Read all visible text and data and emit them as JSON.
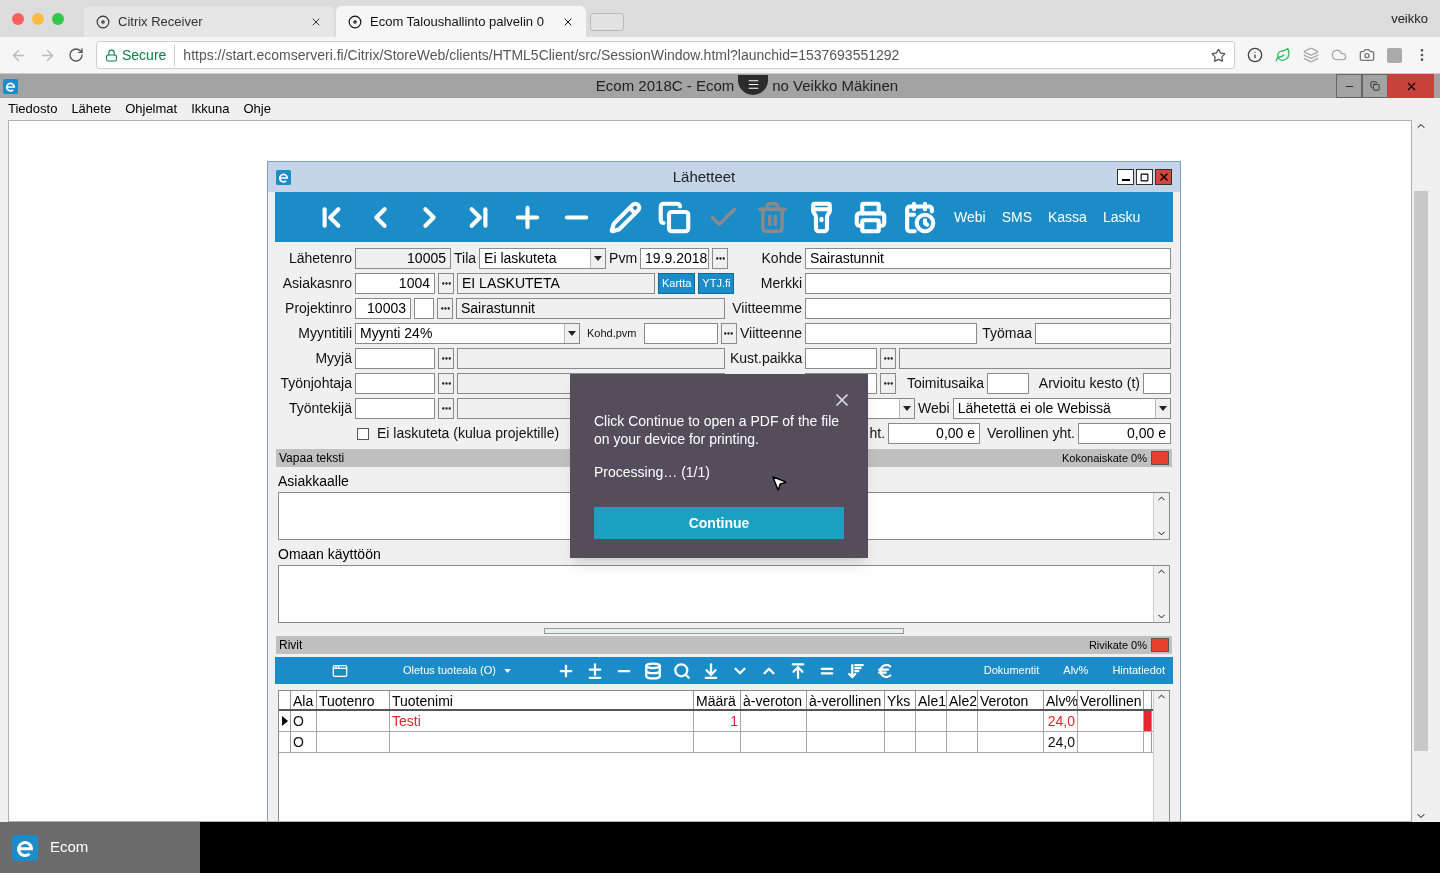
{
  "browser": {
    "tabs": [
      {
        "title": "Citrix Receiver",
        "selected": false
      },
      {
        "title": "Ecom Taloushallinto palvelin 0",
        "selected": true
      }
    ],
    "profile": "veikko",
    "secure_label": "Secure",
    "url": "https://start.ecomserveri.fi/Citrix/StoreWeb/clients/HTML5Client/src/SessionWindow.html?launchid=1537693551292"
  },
  "session_title": [
    "Ecom 2018C - Ecom",
    "no Veikko Mäkinen"
  ],
  "menu": [
    "Tiedosto",
    "Lähete",
    "Ohjelmat",
    "Ikkuna",
    "Ohje"
  ],
  "window": {
    "title": "Lähetteet"
  },
  "toolbar": {
    "tools": [
      {
        "disabled": false
      },
      {
        "disabled": false
      },
      {
        "disabled": false
      },
      {
        "disabled": false
      },
      {
        "disabled": false
      },
      {
        "disabled": false
      },
      {
        "disabled": false
      },
      {
        "disabled": false
      },
      {
        "disabled": true
      },
      {
        "disabled": true
      },
      {
        "disabled": false
      },
      {
        "disabled": false
      },
      {
        "disabled": false
      }
    ],
    "links": [
      "Webi",
      "SMS",
      "Kassa",
      "Lasku"
    ]
  },
  "form": {
    "lahetenro": {
      "label": "Lähetenro",
      "value": "10005"
    },
    "tila": {
      "label": "Tila",
      "value": "Ei laskuteta"
    },
    "pvm": {
      "label": "Pvm",
      "value": "19.9.2018"
    },
    "kohde": {
      "label": "Kohde",
      "value": "Sairastunnit"
    },
    "asiakasnro": {
      "label": "Asiakasnro",
      "value": "1004",
      "name": "EI LASKUTETA"
    },
    "map_buttons": [
      "Kartta",
      "YTJ.fi"
    ],
    "merkki": {
      "label": "Merkki"
    },
    "projektinro": {
      "label": "Projektinro",
      "value": "10003",
      "name": "Sairastunnit"
    },
    "viitteemme": {
      "label": "Viitteemme"
    },
    "myyntitili": {
      "label": "Myyntitili",
      "value": "Myynti 24%"
    },
    "kohd_pvm": {
      "label": "Kohd.pvm"
    },
    "viitteenne": {
      "label": "Viitteenne"
    },
    "tyomaa": {
      "label": "Työmaa"
    },
    "myyja": {
      "label": "Myyjä"
    },
    "kust_paikka": {
      "label": "Kust.paikka"
    },
    "tyonjohtaja": {
      "label": "Työnjohtaja"
    },
    "toimitusaika": {
      "label": "Toimitusaika"
    },
    "arvioitu_kesto": {
      "label": "Arvioitu kesto (t)"
    },
    "tyontekija": {
      "label": "Työntekijä"
    },
    "webi": {
      "label": "Webi",
      "value": "Lähetettä ei ole Webissä"
    },
    "ei_laskuteta": {
      "label": "Ei laskuteta (kulua projektille)",
      "checked": false
    },
    "veroton_yht": {
      "label": "ht.",
      "value": "0,00 e"
    },
    "verollinen_yht": {
      "label": "Verollinen yht.",
      "value": "0,00 e"
    }
  },
  "free_text": {
    "title": "Vapaa teksti",
    "margin": "Kokonaiskate 0%",
    "customer_label": "Asiakkaalle",
    "internal_label": "Omaan käyttöön"
  },
  "rows": {
    "title": "Rivit",
    "margin": "Rivikate 0%",
    "product_area": "Oletus tuoteala (O)",
    "links": [
      "Dokumentit",
      "Alv%",
      "Hintatiedot"
    ],
    "columns": [
      "Ala",
      "Tuotenro",
      "Tuotenimi",
      "Määrä",
      "à-veroton",
      "à-verollinen",
      "Yks",
      "Ale1",
      "Ale2",
      "Veroton",
      "Alv%",
      "Verollinen"
    ],
    "rows": [
      {
        "selected": true,
        "error": true,
        "cells": [
          "O",
          "",
          "Testi",
          "1",
          "",
          "",
          "",
          "",
          "",
          "",
          "24,0",
          ""
        ]
      },
      {
        "selected": false,
        "error": false,
        "cells": [
          "O",
          "",
          "",
          "",
          "",
          "",
          "",
          "",
          "",
          "",
          "24,0",
          ""
        ]
      }
    ]
  },
  "dialog": {
    "message": "Click Continue to open a PDF of the file on your device for printing.",
    "status": "Processing… (1/1)",
    "button": "Continue"
  },
  "taskbar": {
    "app": "Ecom"
  }
}
